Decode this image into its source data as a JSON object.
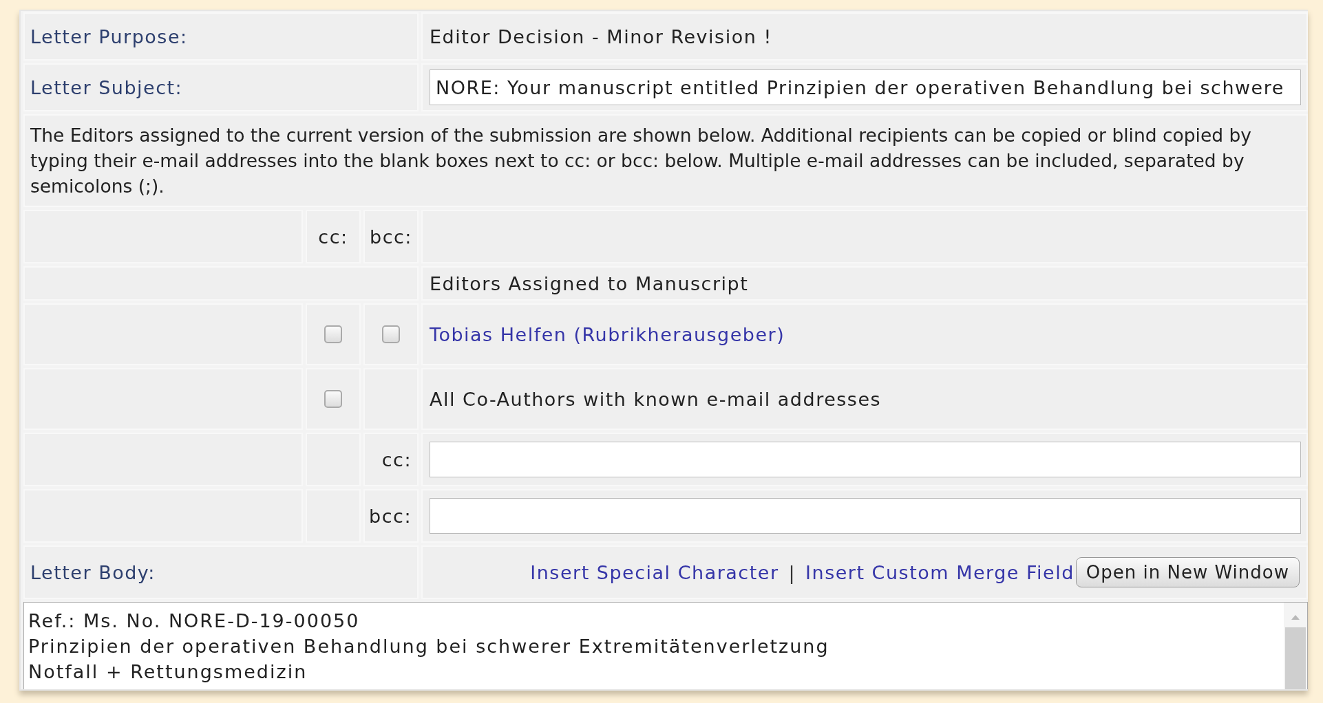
{
  "letter_purpose": {
    "label": "Letter Purpose:",
    "value": "Editor Decision - Minor Revision !"
  },
  "letter_subject": {
    "label": "Letter Subject:",
    "value": "NORE: Your manuscript entitled Prinzipien der operativen Behandlung bei schwere"
  },
  "instructions": "The Editors assigned to the current version of the submission are shown below. Additional recipients can be copied or blind copied by typing their e-mail addresses into the blank boxes next to cc: or bcc: below. Multiple e-mail addresses can be included, separated by semicolons (;).",
  "column_headers": {
    "cc": "cc:",
    "bcc": "bcc:"
  },
  "editors_heading": "Editors Assigned to Manuscript",
  "recipients": [
    {
      "kind": "link",
      "name": "Tobias Helfen (Rubrikherausgeber)",
      "cc": {
        "checked": false
      },
      "bcc": {
        "checked": false
      }
    },
    {
      "kind": "text",
      "name": "All Co-Authors with known e-mail addresses",
      "cc": {
        "checked": false
      }
    }
  ],
  "extra_fields": [
    {
      "label": "cc:"
    },
    {
      "label": "bcc:"
    }
  ],
  "letter_body": {
    "label": "Letter Body:",
    "links": [
      "Insert Special Character",
      "Insert Custom Merge Field"
    ],
    "separator": "|",
    "button": "Open in New Window",
    "lines": [
      "Ref.:  Ms. No. NORE-D-19-00050",
      "Prinzipien der operativen Behandlung bei schwerer Extremitätenverletzung",
      "Notfall +  Rettungsmedizin"
    ]
  }
}
